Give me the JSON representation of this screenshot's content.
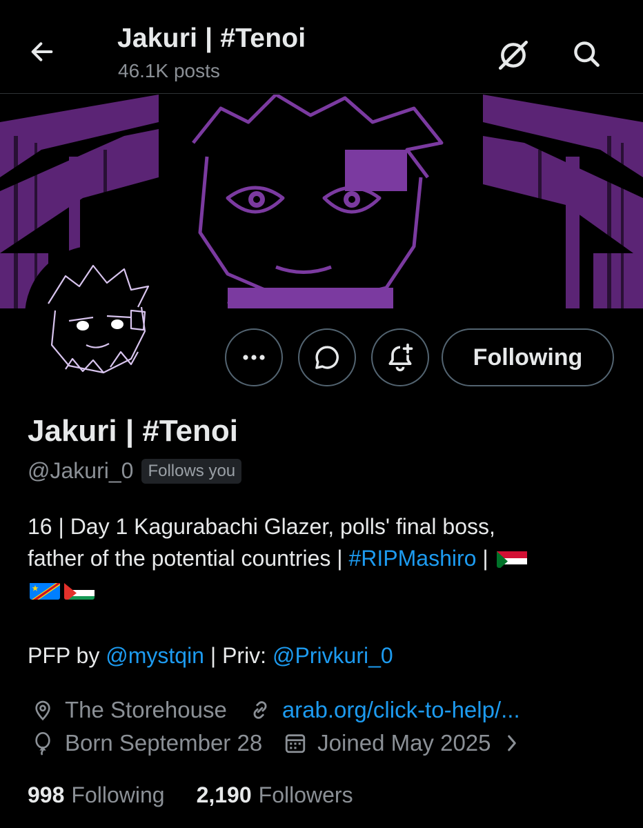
{
  "header": {
    "title": "Jakuri | #Tenoi",
    "post_count": "46.1K posts"
  },
  "colors": {
    "background": "#000000",
    "link": "#1d9bf0",
    "muted": "#8b9096",
    "banner_accent": "#6a2c8a"
  },
  "profile": {
    "display_name": "Jakuri | #Tenoi",
    "handle": "@Jakuri_0",
    "follows_you": "Follows you",
    "bio": {
      "line1": "16 | Day 1 Kagurabachi Glazer, polls' final boss,",
      "line2_prefix": "father of the potential countries | ",
      "hashtag": "#RIPMashiro",
      "separator": " |",
      "flags": [
        "sudan-flag",
        "dr-congo-flag",
        "palestine-flag"
      ]
    },
    "pfp_by_label": "PFP by ",
    "pfp_artist": "@mystqin",
    "priv_label": " | Priv: ",
    "priv_account": "@Privkuri_0",
    "location": "The Storehouse",
    "website": "arab.org/click-to-help/...",
    "birthday": "Born September 28",
    "joined": "Joined May 2025"
  },
  "actions": {
    "more": "more-icon",
    "message": "message-icon",
    "notify": "bell-plus-icon",
    "following_label": "Following"
  },
  "stats": {
    "following_count": "998",
    "following_label": "Following",
    "followers_count": "2,190",
    "followers_label": "Followers"
  }
}
